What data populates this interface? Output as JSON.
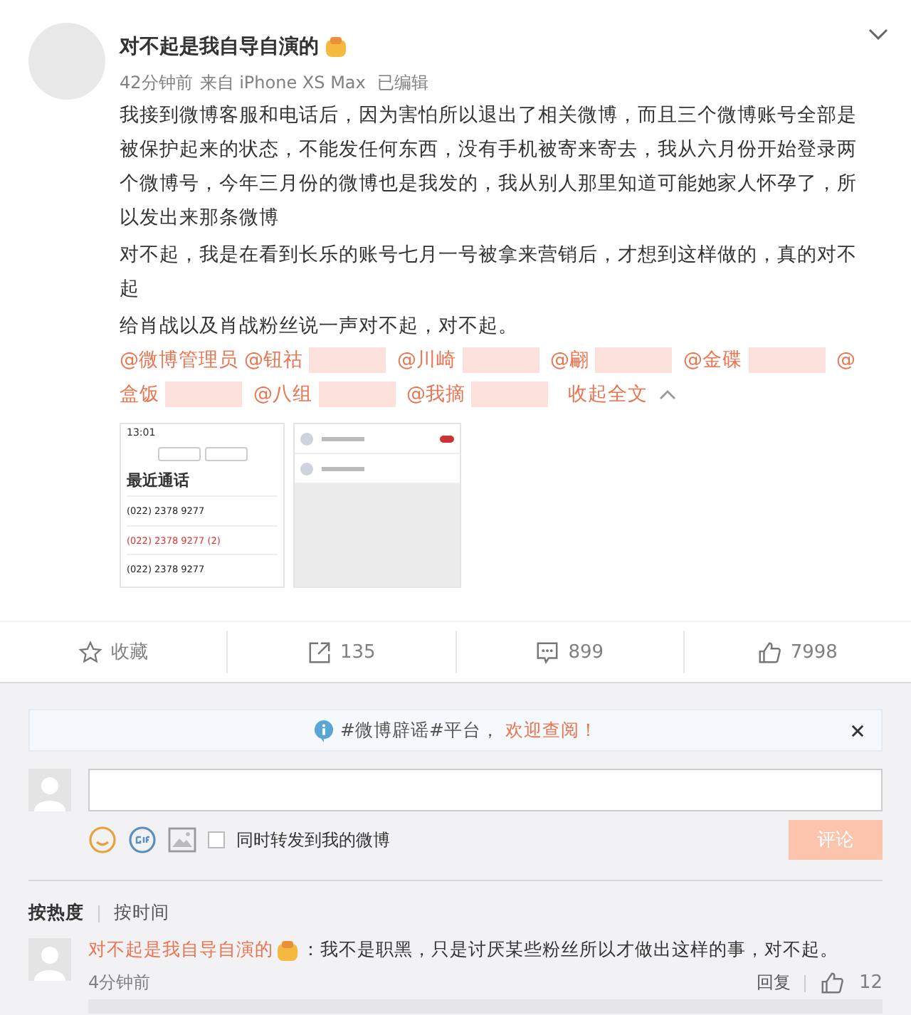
{
  "post": {
    "author": "对不起是我自导自演的",
    "time": "42分钟前",
    "source": "来自 iPhone XS Max",
    "edited": "已编辑",
    "paragraphs": [
      "我接到微博客服和电话后，因为害怕所以退出了相关微博，而且三个微博账号全部是被保护起来的状态，不能发任何东西，没有手机被寄来寄去，我从六月份开始登录两个微博号，今年三月份的微博也是我发的，我从别人那里知道可能她家人怀孕了，所以发出来那条微博",
      "对不起，我是在看到长乐的账号七月一号被拿来营销后，才想到这样做的，真的对不起",
      "给肖战以及肖战粉丝说一声对不起，对不起。"
    ],
    "mentions": [
      {
        "text": "@微博管理员",
        "blurred": false
      },
      {
        "text": "@钮祜",
        "blurred": true
      },
      {
        "text": "@川崎",
        "blurred": true
      },
      {
        "text": "@翩",
        "blurred": true
      },
      {
        "text": "@金碟",
        "blurred": true
      },
      {
        "text": "@",
        "blurred": false
      },
      {
        "text": "盒饭",
        "blurred": true
      },
      {
        "text": "@八组",
        "blurred": true
      },
      {
        "text": "@我摘",
        "blurred": true
      }
    ],
    "collapse": "收起全文",
    "attachment": {
      "clock": "13:01",
      "heading": "最近通话",
      "calls": [
        {
          "number": "(022) 2378 9277",
          "missed": false
        },
        {
          "number": "(022) 2378 9277 (2)",
          "missed": true
        },
        {
          "number": "(022) 2378 9277",
          "missed": false
        }
      ]
    }
  },
  "actions": [
    {
      "kind": "favorite",
      "label": "收藏"
    },
    {
      "kind": "repost",
      "label": "135"
    },
    {
      "kind": "comment",
      "label": "899"
    },
    {
      "kind": "like",
      "label": "7998"
    }
  ],
  "comment_box": {
    "notice": "#微博辟谣#平台，",
    "notice_link": "欢迎查阅！",
    "repost_label": "同时转发到我的微博",
    "repost_checked": false,
    "submit": "评论"
  },
  "sort_tabs": [
    {
      "label": "按热度",
      "selected": true
    },
    {
      "label": "按时间",
      "selected": false
    }
  ],
  "comments": [
    {
      "author": "对不起是我自导自演的",
      "text": "：我不是职黑，只是讨厌某些粉丝所以才做出这样的事，对不起。",
      "time": "4分钟前",
      "reply": "回复",
      "likes": "12"
    }
  ]
}
